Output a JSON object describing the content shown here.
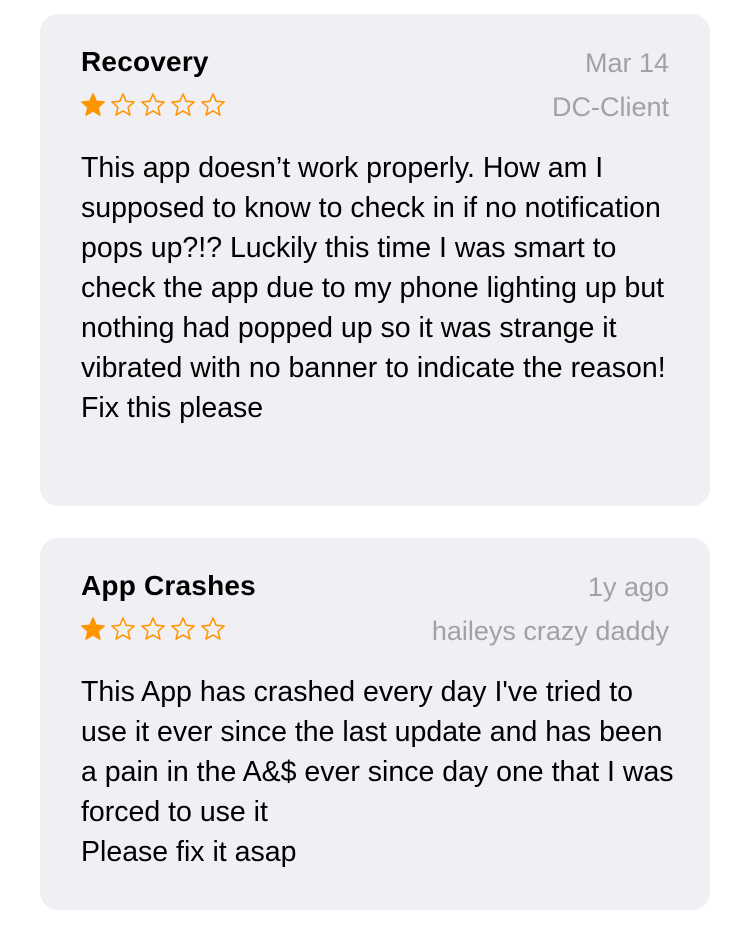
{
  "colors": {
    "card_background": "#efeff4",
    "star_filled": "#ff9500",
    "star_empty_outline": "#ff9500",
    "meta_text": "#a1a1a6",
    "body_text": "#000000"
  },
  "reviews": [
    {
      "title": "Recovery",
      "date": "Mar 14",
      "author": "DC-Client",
      "rating": 1,
      "max_rating": 5,
      "body": "This app doesn’t work properly. How am I supposed to know to check in if no notification pops up?!? Luckily this time I was smart to check the app due to my phone lighting up but nothing had popped up so it was strange it vibrated with no banner to indicate the reason! Fix this please"
    },
    {
      "title": "App Crashes",
      "date": "1y ago",
      "author": "haileys crazy daddy",
      "rating": 1,
      "max_rating": 5,
      "body": "This App has crashed every day I've tried to use it ever since the last update and has been a pain in the A&$ ever since day one that I was forced to use it\nPlease fix it asap"
    }
  ]
}
